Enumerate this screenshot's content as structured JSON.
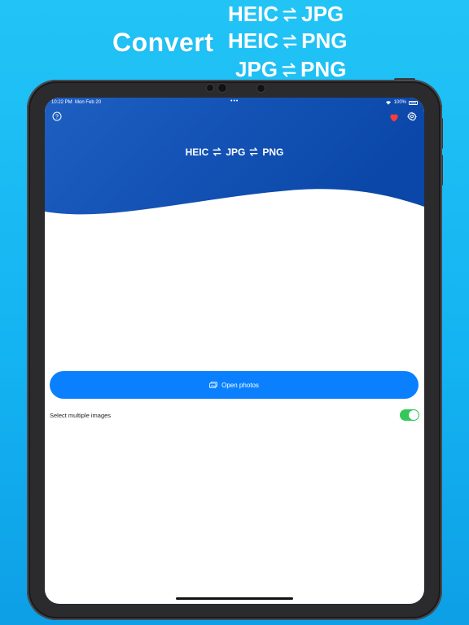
{
  "promo": {
    "convert": "Convert",
    "lines": [
      {
        "left": "HEIC",
        "right": "JPG"
      },
      {
        "left": "HEIC",
        "right": "PNG"
      },
      {
        "left": "JPG",
        "right": "PNG"
      }
    ]
  },
  "status_bar": {
    "time": "10:22 PM",
    "date": "Mon Feb 20",
    "dots": "•••",
    "battery": "100%"
  },
  "header": {
    "title": {
      "part1": "HEIC",
      "part2": "JPG",
      "part3": "PNG"
    },
    "icons": [
      "help-icon",
      "heart-icon",
      "gear-icon"
    ],
    "heart_color": "#ff3b3b",
    "gradient_start": "#1a57b8",
    "gradient_end": "#0b4fb0"
  },
  "main": {
    "open_button_label": "Open photos",
    "open_button_icon": "photos-icon",
    "toggle_label": "Select multiple images",
    "toggle_on": true,
    "accent": "#0a80ff",
    "toggle_color": "#34c759"
  }
}
